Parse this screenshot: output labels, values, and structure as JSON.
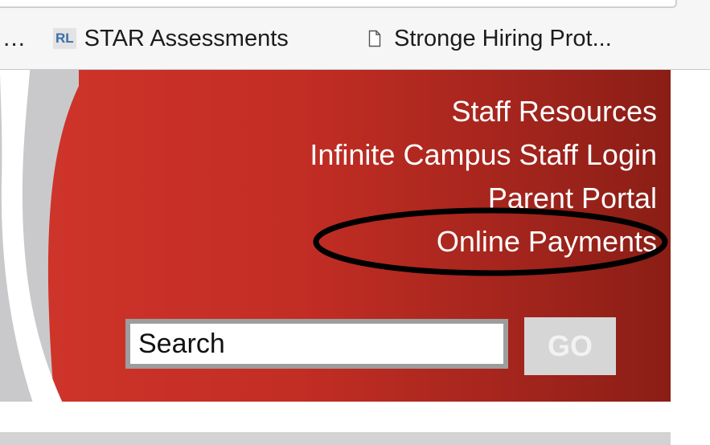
{
  "bookmarks_bar": {
    "overflow_label": "...",
    "items": [
      {
        "icon_text": "RL",
        "label": "STAR Assessments",
        "icon": "rl-favicon"
      },
      {
        "label": "Stronge Hiring Prot...",
        "icon": "page-icon"
      }
    ]
  },
  "header": {
    "links": [
      {
        "label": "Staff Resources"
      },
      {
        "label": "Infinite Campus Staff Login"
      },
      {
        "label": "Parent Portal"
      },
      {
        "label": "Online Payments"
      }
    ],
    "search": {
      "placeholder": "Search",
      "button_label": "GO"
    }
  },
  "colors": {
    "banner_left": "#d0352b",
    "banner_right": "#8a1e16",
    "link_text": "#ffffff",
    "go_button": "#d6d6d6",
    "annotation": "#000000"
  }
}
